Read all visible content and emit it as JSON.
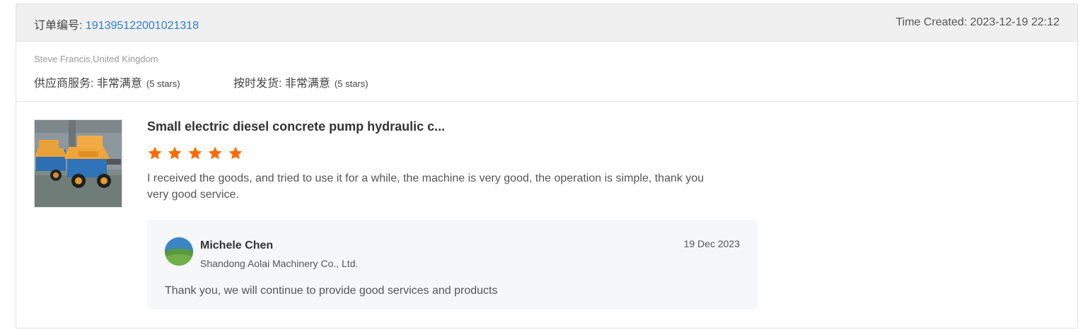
{
  "order": {
    "label": "订单编号: ",
    "number": "191395122001021318",
    "time_created": "Time Created: 2023-12-19 22:12"
  },
  "buyer": {
    "name_country": "Steve Francis,United Kingdom"
  },
  "ratings": {
    "supplier_service": {
      "label": "供应商服务: 非常满意",
      "stars_text": "(5 stars)",
      "stars": 5
    },
    "on_time_shipping": {
      "label": "按时发货: 非常满意",
      "stars_text": "(5 stars)",
      "stars": 5
    }
  },
  "product": {
    "title": "Small electric diesel concrete pump hydraulic c...",
    "rating": 5,
    "review": "I received the goods, and tried to use it for a while, the machine is very good, the operation is simple, thank you very good service."
  },
  "reply": {
    "name": "Michele Chen",
    "company": "Shandong Aolai Machinery Co., Ltd.",
    "date": "19 Dec 2023",
    "text": "Thank you, we will continue to provide good services and products"
  },
  "colors": {
    "accent_link": "#2f7fc7",
    "star": "#ff6a00",
    "header_bg": "#f0f0f0",
    "reply_bg": "#f5f7f9"
  },
  "icons": {
    "star": "star-icon",
    "avatar": "avatar",
    "product": "product-image"
  }
}
